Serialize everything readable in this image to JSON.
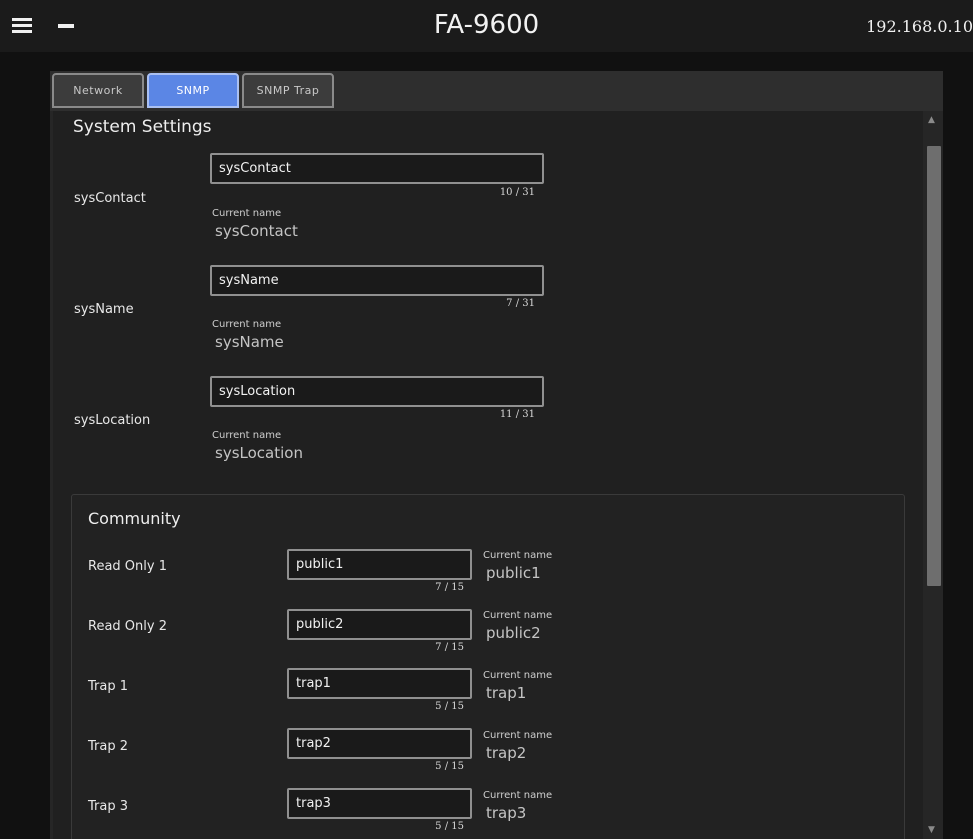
{
  "header": {
    "title": "FA-9600",
    "ip_address": "192.168.0.10"
  },
  "tabs": [
    {
      "label": "Network",
      "active": false
    },
    {
      "label": "SNMP",
      "active": true
    },
    {
      "label": "SNMP Trap",
      "active": false
    }
  ],
  "system_settings": {
    "title": "System Settings",
    "current_name_label": "Current name",
    "fields": [
      {
        "label": "sysContact",
        "value": "sysContact",
        "counter": "10 / 31",
        "current": "sysContact"
      },
      {
        "label": "sysName",
        "value": "sysName",
        "counter": "7 / 31",
        "current": "sysName"
      },
      {
        "label": "sysLocation",
        "value": "sysLocation",
        "counter": "11 / 31",
        "current": "sysLocation"
      }
    ]
  },
  "community": {
    "title": "Community",
    "current_name_label": "Current name",
    "rows": [
      {
        "label": "Read Only 1",
        "value": "public1",
        "counter": "7 / 15",
        "current": "public1"
      },
      {
        "label": "Read Only 2",
        "value": "public2",
        "counter": "7 / 15",
        "current": "public2"
      },
      {
        "label": "Trap 1",
        "value": "trap1",
        "counter": "5 / 15",
        "current": "trap1"
      },
      {
        "label": "Trap 2",
        "value": "trap2",
        "counter": "5 / 15",
        "current": "trap2"
      },
      {
        "label": "Trap 3",
        "value": "trap3",
        "counter": "5 / 15",
        "current": "trap3"
      }
    ]
  },
  "colors": {
    "active_tab": "#5b86e5",
    "background": "#111111"
  },
  "icons": {
    "menu": "hamburger-menu-icon",
    "minimize": "minus-icon",
    "scroll_up": "chevron-up-icon",
    "scroll_down": "chevron-down-icon"
  }
}
